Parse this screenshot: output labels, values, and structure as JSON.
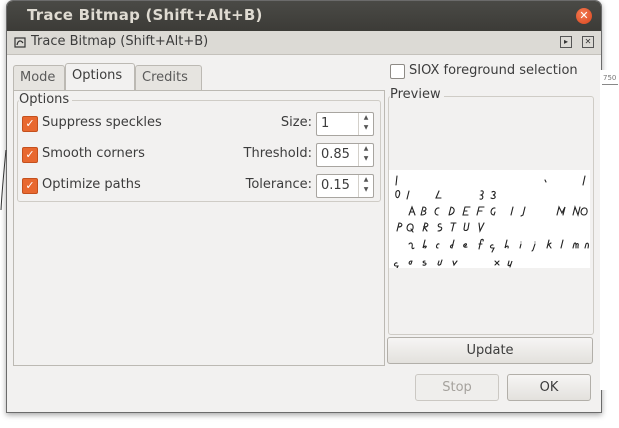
{
  "window": {
    "title": "Trace Bitmap (Shift+Alt+B)"
  },
  "dock": {
    "title": "Trace Bitmap (Shift+Alt+B)"
  },
  "tabs": [
    {
      "label": "Mode",
      "active": false
    },
    {
      "label": "Options",
      "active": true
    },
    {
      "label": "Credits",
      "active": false
    }
  ],
  "options": {
    "group_label": "Options",
    "rows": [
      {
        "label": "Suppress speckles",
        "checked": true,
        "field_label": "Size:",
        "value": "1"
      },
      {
        "label": "Smooth corners",
        "checked": true,
        "field_label": "Threshold:",
        "value": "0.85"
      },
      {
        "label": "Optimize paths",
        "checked": true,
        "field_label": "Tolerance:",
        "value": "0.15"
      }
    ]
  },
  "siox": {
    "label": "SIOX foreground selection",
    "checked": false
  },
  "preview": {
    "label": "Preview"
  },
  "buttons": {
    "update": "Update",
    "stop": "Stop",
    "ok": "OK"
  },
  "ruler": {
    "number": "750"
  },
  "colors": {
    "accent": "#e8682f",
    "titlebar": "#3c3b37"
  }
}
